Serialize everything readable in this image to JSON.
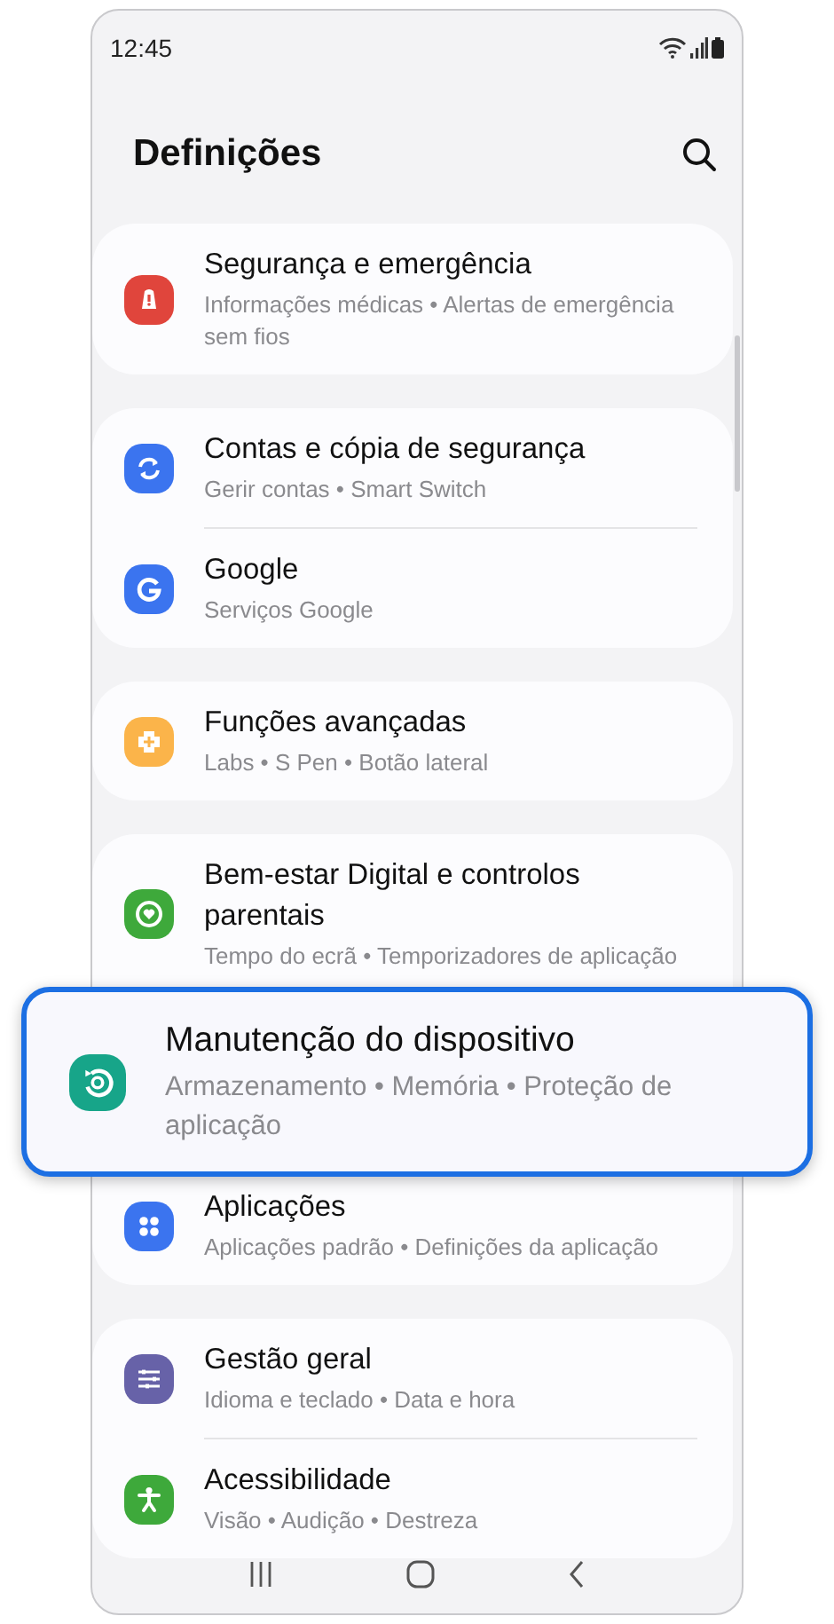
{
  "status_bar": {
    "time": "12:45"
  },
  "header": {
    "title": "Definições"
  },
  "groups": [
    {
      "items": [
        {
          "title": "Segurança e emergência",
          "subtitle": "Informações médicas • Alertas de emergência sem fios",
          "highlighted": false
        }
      ]
    },
    {
      "items": [
        {
          "title": "Contas e cópia de segurança",
          "subtitle": "Gerir contas • Smart Switch",
          "highlighted": false
        },
        {
          "title": "Google",
          "subtitle": "Serviços Google",
          "highlighted": false
        }
      ]
    },
    {
      "items": [
        {
          "title": "Funções avançadas",
          "subtitle": "Labs • S Pen • Botão lateral",
          "highlighted": false
        }
      ]
    },
    {
      "items": [
        {
          "title": "Bem-estar Digital e controlos parentais",
          "subtitle": "Tempo do ecrã • Temporizadores de aplicação",
          "highlighted": false
        },
        {
          "title": "Manutenção do dispositivo",
          "subtitle": "Armazenamento • Memória • Proteção de aplicação",
          "highlighted": true
        },
        {
          "title": "Aplicações",
          "subtitle": "Aplicações padrão • Definições da aplicação",
          "highlighted": false
        }
      ]
    },
    {
      "items": [
        {
          "title": "Gestão geral",
          "subtitle": "Idioma e teclado • Data e hora",
          "highlighted": false
        },
        {
          "title": "Acessibilidade",
          "subtitle": "Visão • Audição • Destreza",
          "highlighted": false
        }
      ]
    }
  ]
}
